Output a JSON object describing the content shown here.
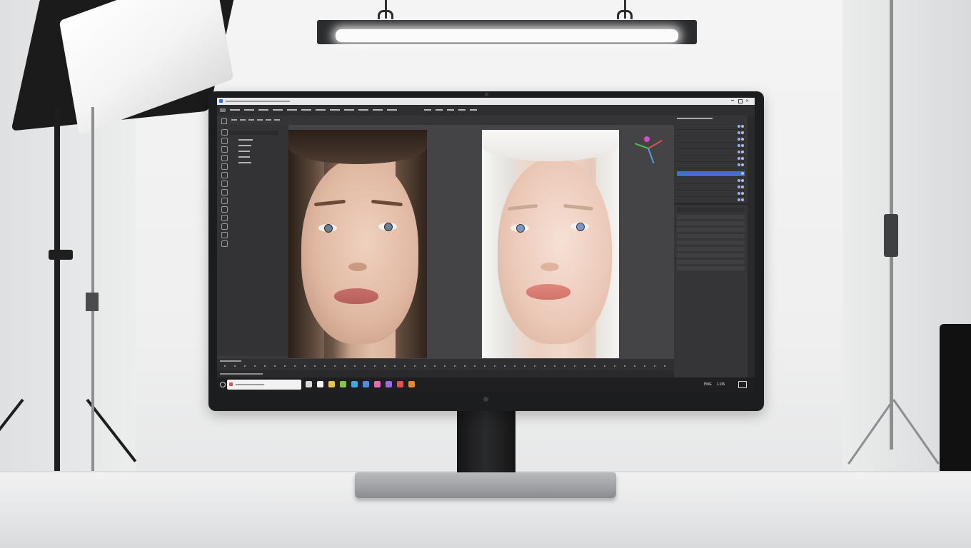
{
  "taskbar": {
    "apps": [
      {
        "name": "app-1",
        "color": "#d9d9d9"
      },
      {
        "name": "app-2",
        "color": "#f2f2f2"
      },
      {
        "name": "app-3",
        "color": "#e6c34a"
      },
      {
        "name": "app-4",
        "color": "#8bc34a"
      },
      {
        "name": "app-5",
        "color": "#3ea8e6"
      },
      {
        "name": "app-6",
        "color": "#4f8de0"
      },
      {
        "name": "app-7",
        "color": "#e06fb3"
      },
      {
        "name": "app-8",
        "color": "#9b6de0"
      },
      {
        "name": "app-9",
        "color": "#e0514f"
      },
      {
        "name": "app-10",
        "color": "#e08a3a"
      }
    ],
    "clock": "1:06",
    "language": "ENG"
  },
  "layers_panel": {
    "selected_row_color": "#3f6fd6"
  },
  "colors": {
    "screen_bg": "#3a3a3c",
    "panel_bg": "#353537",
    "accent": "#3f6fd6"
  }
}
